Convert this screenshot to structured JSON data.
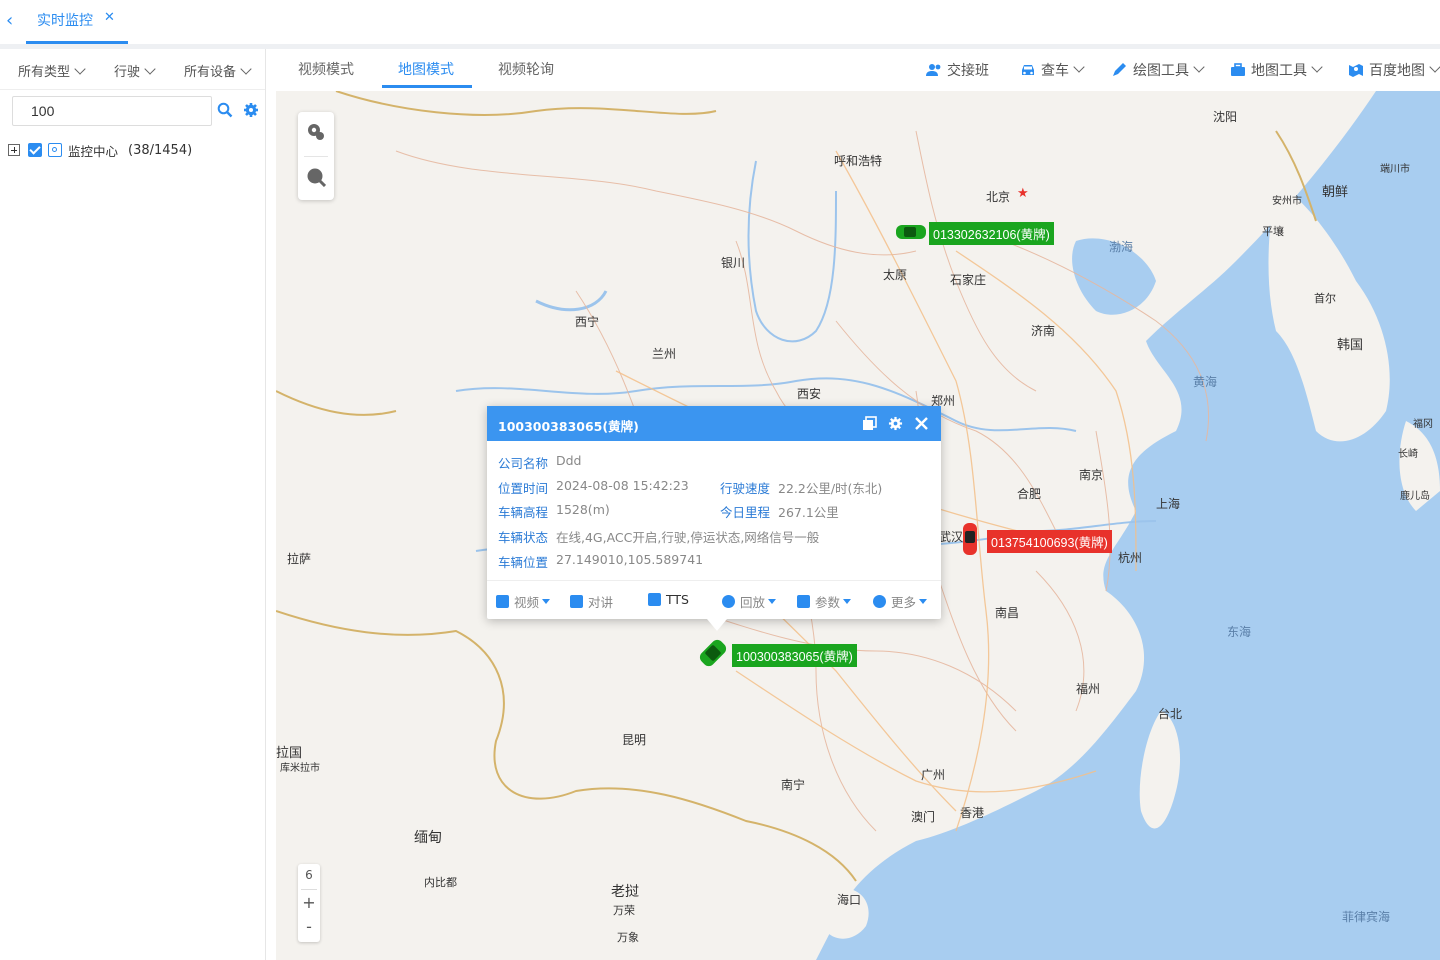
{
  "top_tabs": {
    "back_icon": "chevron-left-icon",
    "active_tab": "实时监控",
    "close_icon": "close-icon"
  },
  "left_panel": {
    "filters": [
      "所有类型",
      "行驶",
      "所有设备"
    ],
    "search": {
      "value": "100",
      "search_icon": "search-icon",
      "settings_icon": "gear-icon"
    },
    "tree": {
      "label": "监控中心",
      "count": "(38/1454)"
    }
  },
  "modes": [
    {
      "label": "视频模式",
      "active": false
    },
    {
      "label": "地图模式",
      "active": true
    },
    {
      "label": "视频轮询",
      "active": false
    }
  ],
  "tools": [
    {
      "label": "交接班",
      "icon": "users-icon",
      "dropdown": false
    },
    {
      "label": "查车",
      "icon": "car-icon",
      "dropdown": true
    },
    {
      "label": "绘图工具",
      "icon": "pencil-icon",
      "dropdown": true
    },
    {
      "label": "地图工具",
      "icon": "toolbox-icon",
      "dropdown": true
    },
    {
      "label": "百度地图",
      "icon": "map-icon",
      "dropdown": true
    }
  ],
  "map": {
    "zoom_level": "6",
    "zoom_in": "+",
    "zoom_out": "-",
    "cities": [
      {
        "id": "shenyang",
        "name": "沈阳"
      },
      {
        "id": "huhehaote",
        "name": "呼和浩特"
      },
      {
        "id": "beijing",
        "name": "北京"
      },
      {
        "id": "yinchuan",
        "name": "银川"
      },
      {
        "id": "taiyuan",
        "name": "太原"
      },
      {
        "id": "shijiazhuang",
        "name": "石家庄"
      },
      {
        "id": "xining",
        "name": "西宁"
      },
      {
        "id": "lanzhou",
        "name": "兰州"
      },
      {
        "id": "jinan",
        "name": "济南"
      },
      {
        "id": "xian",
        "name": "西安"
      },
      {
        "id": "zhengzhou",
        "name": "郑州"
      },
      {
        "id": "nanjing",
        "name": "南京"
      },
      {
        "id": "hefei",
        "name": "合肥"
      },
      {
        "id": "shanghai",
        "name": "上海"
      },
      {
        "id": "hangzhou",
        "name": "杭州"
      },
      {
        "id": "wuhan",
        "name": "武汉"
      },
      {
        "id": "lasa",
        "name": "拉萨"
      },
      {
        "id": "nanchang",
        "name": "南昌"
      },
      {
        "id": "fuzhou",
        "name": "福州"
      },
      {
        "id": "taibei",
        "name": "台北"
      },
      {
        "id": "kunming",
        "name": "昆明"
      },
      {
        "id": "guangzhou",
        "name": "广州"
      },
      {
        "id": "nanning",
        "name": "南宁"
      },
      {
        "id": "aomen",
        "name": "澳门"
      },
      {
        "id": "xianggang",
        "name": "香港"
      },
      {
        "id": "haikou",
        "name": "海口"
      },
      {
        "id": "miandian",
        "name": "缅甸"
      },
      {
        "id": "neibidu",
        "name": "内比都"
      },
      {
        "id": "laowo",
        "name": "老挝"
      },
      {
        "id": "wanrong",
        "name": "万荣"
      },
      {
        "id": "wanxiang",
        "name": "万象"
      },
      {
        "id": "chaoxian",
        "name": "朝鲜"
      },
      {
        "id": "andong",
        "name": "安州市"
      },
      {
        "id": "pingrang",
        "name": "平壤"
      },
      {
        "id": "shouer",
        "name": "首尔"
      },
      {
        "id": "hanguo",
        "name": "韩国"
      },
      {
        "id": "duanchuan",
        "name": "端川市"
      },
      {
        "id": "fugang",
        "name": "福冈"
      },
      {
        "id": "changqi",
        "name": "长崎"
      },
      {
        "id": "luer",
        "name": "鹿儿岛"
      },
      {
        "id": "lagou",
        "name": "拉国"
      },
      {
        "id": "kumi",
        "name": "库米拉市"
      }
    ],
    "seas": [
      {
        "id": "bohai",
        "name": "渤海"
      },
      {
        "id": "huanghai",
        "name": "黄海"
      },
      {
        "id": "donghai",
        "name": "东海"
      },
      {
        "id": "feilvbin",
        "name": "菲律宾海"
      }
    ],
    "vehicles": [
      {
        "id": "v1",
        "label": "013302632106(黄牌)",
        "color": "#1aa51f"
      },
      {
        "id": "v2",
        "label": "013754100693(黄牌)",
        "color": "#e8322b"
      },
      {
        "id": "v3",
        "label": "100300383065(黄牌)",
        "color": "#1aa51f"
      }
    ]
  },
  "popup": {
    "title": "100300383065(黄牌)",
    "fields": {
      "company": {
        "label": "公司名称",
        "value": "Ddd"
      },
      "time": {
        "label": "位置时间",
        "value": "2024-08-08 15:42:23"
      },
      "speed": {
        "label": "行驶速度",
        "value": "22.2公里/时(东北)"
      },
      "altitude": {
        "label": "车辆高程",
        "value": "1528(m)"
      },
      "mileage": {
        "label": "今日里程",
        "value": "267.1公里"
      },
      "status": {
        "label": "车辆状态",
        "value": "在线,4G,ACC开启,行驶,停运状态,网络信号一般"
      },
      "position": {
        "label": "车辆位置",
        "value": "27.149010,105.589741"
      }
    },
    "actions": [
      {
        "label": "视频",
        "dropdown": true
      },
      {
        "label": "对讲",
        "dropdown": false
      },
      {
        "label": "TTS",
        "dropdown": false
      },
      {
        "label": "回放",
        "dropdown": true
      },
      {
        "label": "参数",
        "dropdown": true
      },
      {
        "label": "更多",
        "dropdown": true
      }
    ]
  },
  "colors": {
    "accent": "#2b8cf0",
    "popup_header": "#3b95f0",
    "vehicle_green": "#1aa51f",
    "vehicle_red": "#e8322b",
    "sea": "#a8cdf0"
  }
}
